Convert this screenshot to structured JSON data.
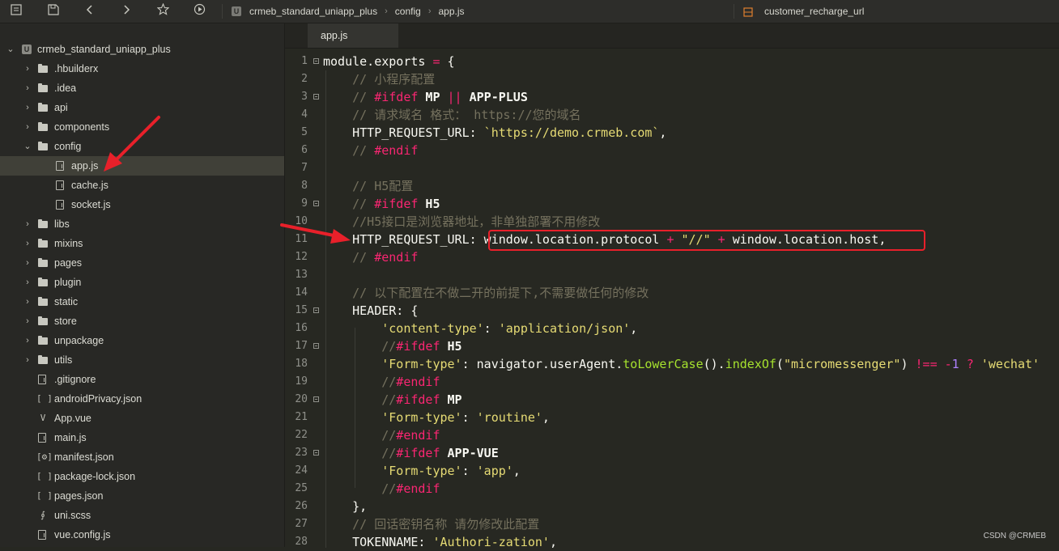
{
  "toolbar": {
    "icons": [
      "file-tree-icon",
      "save-icon",
      "back-icon",
      "forward-icon",
      "star-icon",
      "run-icon"
    ]
  },
  "breadcrumb": {
    "icon_letter": "U",
    "items": [
      "crmeb_standard_uniapp_plus",
      "config",
      "app.js"
    ]
  },
  "symbol_search": {
    "value": "customer_recharge_url"
  },
  "sidebar": {
    "project": "crmeb_standard_uniapp_plus",
    "project_icon_letter": "U",
    "items": [
      {
        "label": ".hbuilderx",
        "kind": "folder",
        "depth": 1,
        "expanded": false
      },
      {
        "label": ".idea",
        "kind": "folder",
        "depth": 1,
        "expanded": false
      },
      {
        "label": "api",
        "kind": "folder",
        "depth": 1,
        "expanded": false
      },
      {
        "label": "components",
        "kind": "folder",
        "depth": 1,
        "expanded": false
      },
      {
        "label": "config",
        "kind": "folder",
        "depth": 1,
        "expanded": true
      },
      {
        "label": "app.js",
        "kind": "file",
        "depth": 2,
        "selected": true
      },
      {
        "label": "cache.js",
        "kind": "file",
        "depth": 2
      },
      {
        "label": "socket.js",
        "kind": "file",
        "depth": 2
      },
      {
        "label": "libs",
        "kind": "folder",
        "depth": 1,
        "expanded": false
      },
      {
        "label": "mixins",
        "kind": "folder",
        "depth": 1,
        "expanded": false
      },
      {
        "label": "pages",
        "kind": "folder",
        "depth": 1,
        "expanded": false
      },
      {
        "label": "plugin",
        "kind": "folder",
        "depth": 1,
        "expanded": false
      },
      {
        "label": "static",
        "kind": "folder",
        "depth": 1,
        "expanded": false
      },
      {
        "label": "store",
        "kind": "folder",
        "depth": 1,
        "expanded": false
      },
      {
        "label": "unpackage",
        "kind": "folder",
        "depth": 1,
        "expanded": false
      },
      {
        "label": "utils",
        "kind": "folder",
        "depth": 1,
        "expanded": false
      },
      {
        "label": ".gitignore",
        "kind": "file",
        "depth": 1
      },
      {
        "label": "androidPrivacy.json",
        "kind": "json",
        "depth": 1
      },
      {
        "label": "App.vue",
        "kind": "vue",
        "depth": 1
      },
      {
        "label": "main.js",
        "kind": "file",
        "depth": 1
      },
      {
        "label": "manifest.json",
        "kind": "manifest",
        "depth": 1
      },
      {
        "label": "package-lock.json",
        "kind": "json",
        "depth": 1
      },
      {
        "label": "pages.json",
        "kind": "json",
        "depth": 1
      },
      {
        "label": "uni.scss",
        "kind": "scss",
        "depth": 1
      },
      {
        "label": "vue.config.js",
        "kind": "file",
        "depth": 1
      }
    ]
  },
  "editor": {
    "tab": "app.js",
    "lines": [
      {
        "n": "1",
        "fold": true,
        "indent": 0,
        "tokens": [
          [
            "t",
            "module.exports "
          ],
          [
            "k",
            "="
          ],
          [
            "t",
            " {"
          ]
        ]
      },
      {
        "n": "2",
        "fold": false,
        "indent": 1,
        "tokens": [
          [
            "c",
            "// 小程序配置"
          ]
        ]
      },
      {
        "n": "3",
        "fold": true,
        "indent": 1,
        "tokens": [
          [
            "c",
            "// "
          ],
          [
            "k",
            "#ifdef"
          ],
          [
            "t",
            " "
          ],
          [
            "b",
            "MP"
          ],
          [
            "t",
            " "
          ],
          [
            "k",
            "||"
          ],
          [
            "t",
            " "
          ],
          [
            "b",
            "APP-PLUS"
          ]
        ]
      },
      {
        "n": "4",
        "fold": false,
        "indent": 1,
        "tokens": [
          [
            "c",
            "// 请求域名 格式： https://您的域名"
          ]
        ]
      },
      {
        "n": "5",
        "fold": false,
        "indent": 1,
        "tokens": [
          [
            "t",
            "HTTP_REQUEST_URL: "
          ],
          [
            "s",
            "`https://demo.crmeb.com`"
          ],
          [
            "t",
            ","
          ]
        ]
      },
      {
        "n": "6",
        "fold": false,
        "indent": 1,
        "tokens": [
          [
            "c",
            "// "
          ],
          [
            "k",
            "#endif"
          ]
        ]
      },
      {
        "n": "7",
        "fold": false,
        "indent": 1,
        "tokens": []
      },
      {
        "n": "8",
        "fold": false,
        "indent": 1,
        "tokens": [
          [
            "c",
            "// H5配置"
          ]
        ]
      },
      {
        "n": "9",
        "fold": true,
        "indent": 1,
        "tokens": [
          [
            "c",
            "// "
          ],
          [
            "k",
            "#ifdef"
          ],
          [
            "t",
            " "
          ],
          [
            "b",
            "H5"
          ]
        ]
      },
      {
        "n": "10",
        "fold": false,
        "indent": 1,
        "tokens": [
          [
            "c",
            "//H5接口是浏览器地址，非单独部署不用修改"
          ]
        ]
      },
      {
        "n": "11",
        "fold": false,
        "indent": 1,
        "tokens": [
          [
            "t",
            "HTTP_REQUEST_URL: window.location.protocol "
          ],
          [
            "k",
            "+"
          ],
          [
            "t",
            " "
          ],
          [
            "s",
            "\"//\""
          ],
          [
            "t",
            " "
          ],
          [
            "k",
            "+"
          ],
          [
            "t",
            " window.location.host,"
          ]
        ]
      },
      {
        "n": "12",
        "fold": false,
        "indent": 1,
        "tokens": [
          [
            "c",
            "// "
          ],
          [
            "k",
            "#endif"
          ]
        ]
      },
      {
        "n": "13",
        "fold": false,
        "indent": 1,
        "tokens": []
      },
      {
        "n": "14",
        "fold": false,
        "indent": 1,
        "tokens": [
          [
            "c",
            "// 以下配置在不做二开的前提下,不需要做任何的修改"
          ]
        ]
      },
      {
        "n": "15",
        "fold": true,
        "indent": 1,
        "tokens": [
          [
            "t",
            "HEADER: {"
          ]
        ]
      },
      {
        "n": "16",
        "fold": false,
        "indent": 2,
        "tokens": [
          [
            "s",
            "'content-type'"
          ],
          [
            "t",
            ": "
          ],
          [
            "s",
            "'application/json'"
          ],
          [
            "t",
            ","
          ]
        ]
      },
      {
        "n": "17",
        "fold": true,
        "indent": 2,
        "tokens": [
          [
            "c",
            "//"
          ],
          [
            "k",
            "#ifdef"
          ],
          [
            "t",
            " "
          ],
          [
            "b",
            "H5"
          ]
        ]
      },
      {
        "n": "18",
        "fold": false,
        "indent": 2,
        "tokens": [
          [
            "s",
            "'Form-type'"
          ],
          [
            "t",
            ": navigator.userAgent."
          ],
          [
            "f",
            "toLowerCase"
          ],
          [
            "t",
            "()."
          ],
          [
            "f",
            "indexOf"
          ],
          [
            "t",
            "("
          ],
          [
            "s",
            "\"micromessenger\""
          ],
          [
            "t",
            ") "
          ],
          [
            "k",
            "!=="
          ],
          [
            "t",
            " "
          ],
          [
            "k",
            "-"
          ],
          [
            "n",
            "1"
          ],
          [
            "t",
            " "
          ],
          [
            "k",
            "?"
          ],
          [
            "t",
            " "
          ],
          [
            "s",
            "'wechat'"
          ]
        ]
      },
      {
        "n": "19",
        "fold": false,
        "indent": 2,
        "tokens": [
          [
            "c",
            "//"
          ],
          [
            "k",
            "#endif"
          ]
        ]
      },
      {
        "n": "20",
        "fold": true,
        "indent": 2,
        "tokens": [
          [
            "c",
            "//"
          ],
          [
            "k",
            "#ifdef"
          ],
          [
            "t",
            " "
          ],
          [
            "b",
            "MP"
          ]
        ]
      },
      {
        "n": "21",
        "fold": false,
        "indent": 2,
        "tokens": [
          [
            "s",
            "'Form-type'"
          ],
          [
            "t",
            ": "
          ],
          [
            "s",
            "'routine'"
          ],
          [
            "t",
            ","
          ]
        ]
      },
      {
        "n": "22",
        "fold": false,
        "indent": 2,
        "tokens": [
          [
            "c",
            "//"
          ],
          [
            "k",
            "#endif"
          ]
        ]
      },
      {
        "n": "23",
        "fold": true,
        "indent": 2,
        "tokens": [
          [
            "c",
            "//"
          ],
          [
            "k",
            "#ifdef"
          ],
          [
            "t",
            " "
          ],
          [
            "b",
            "APP-VUE"
          ]
        ]
      },
      {
        "n": "24",
        "fold": false,
        "indent": 2,
        "tokens": [
          [
            "s",
            "'Form-type'"
          ],
          [
            "t",
            ": "
          ],
          [
            "s",
            "'app'"
          ],
          [
            "t",
            ","
          ]
        ]
      },
      {
        "n": "25",
        "fold": false,
        "indent": 2,
        "tokens": [
          [
            "c",
            "//"
          ],
          [
            "k",
            "#endif"
          ]
        ]
      },
      {
        "n": "26",
        "fold": false,
        "indent": 1,
        "tokens": [
          [
            "t",
            "},"
          ]
        ]
      },
      {
        "n": "27",
        "fold": false,
        "indent": 1,
        "tokens": [
          [
            "c",
            "// 回话密钥名称 请勿修改此配置"
          ]
        ]
      },
      {
        "n": "28",
        "fold": false,
        "indent": 1,
        "tokens": [
          [
            "t",
            "TOKENNAME: "
          ],
          [
            "s",
            "'Authori-zation'"
          ],
          [
            "t",
            ","
          ]
        ]
      }
    ]
  },
  "annotation": {
    "box_color": "#e8202a",
    "arrow_color": "#e8202a"
  },
  "watermark": "CSDN @CRMEB"
}
